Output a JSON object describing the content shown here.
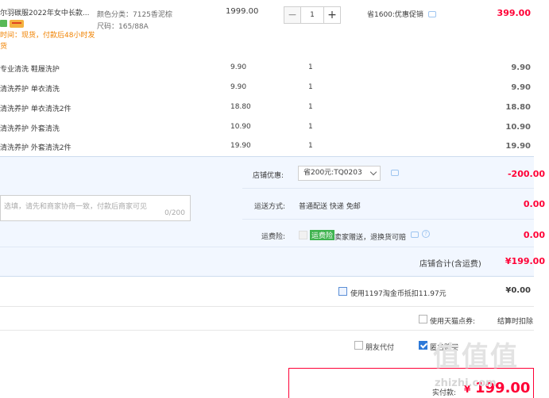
{
  "item": {
    "title": "尔羽碳服2022年女中长款...",
    "ship_time": "时间：现货，付款后48小时发货",
    "color_label": "颜色分类：7125香泥棕",
    "size_label": "尺码：165/88A",
    "unit_price": "1999.00",
    "qty": "1",
    "qty_minus": "−",
    "qty_plus": "+",
    "promo": "省1600:优惠促销",
    "total": "399.00"
  },
  "services": [
    {
      "name": "专业清洗 鞋履洗护",
      "price": "9.90",
      "qty": "1",
      "total": "9.90"
    },
    {
      "name": "清洗养护 单衣清洗",
      "price": "9.90",
      "qty": "1",
      "total": "9.90"
    },
    {
      "name": "清洗养护 单衣清洗2件",
      "price": "18.80",
      "qty": "1",
      "total": "18.80"
    },
    {
      "name": "清洗养护 外套清洗",
      "price": "10.90",
      "qty": "1",
      "total": "10.90"
    },
    {
      "name": "清洗养护 外套清洗2件",
      "price": "19.90",
      "qty": "1",
      "total": "19.90"
    }
  ],
  "order": {
    "coupon_label": "店铺优惠:",
    "coupon_value": "省200元:TQ0203",
    "coupon_amount": "-200.00",
    "message_placeholder": "选填，请先和商家协商一致，付款后商家可见",
    "message_count": "0/200",
    "shipping_label": "运送方式:",
    "shipping_value": "普通配送 快递 免邮",
    "shipping_amount": "0.00",
    "insurance_label": "运费险:",
    "insurance_tag": "运费险",
    "insurance_text": "卖家赠送，退换货可赔",
    "insurance_amount": "0.00",
    "store_total_label": "店铺合计(含运费)",
    "store_total": "¥199.00"
  },
  "footer": {
    "taojinbi": "使用1197淘金币抵扣11.97元",
    "taojinbi_amount": "¥0.00",
    "tmall_points": "使用天猫点券:",
    "tmall_points_note": "结算时扣除",
    "friend_pay": "朋友代付",
    "anonymous": "匿名购买",
    "pay_label": "实付款:",
    "pay_currency": "¥",
    "pay_amount": "199.00"
  },
  "watermark": {
    "logo": "值值值",
    "domain": "zhizhi.com"
  },
  "colors": {
    "price_red": "#ff0036",
    "panel_bg": "#f2f7ff",
    "link_blue": "#2d79d8",
    "ship_orange": "#f08200"
  }
}
